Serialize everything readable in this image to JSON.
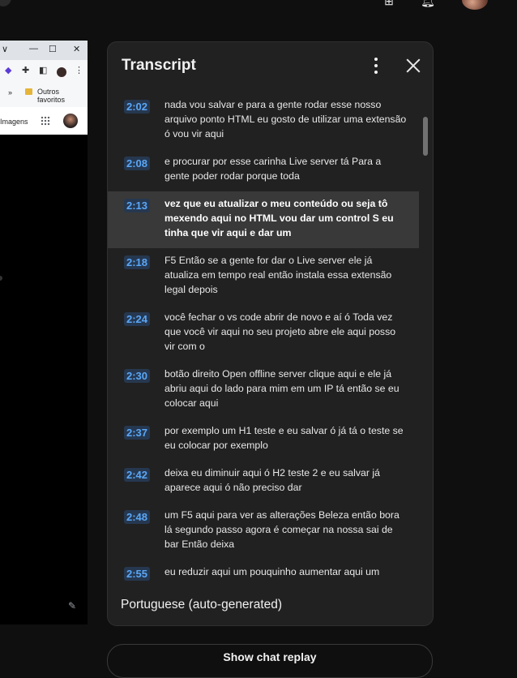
{
  "browser_preview": {
    "window_controls": [
      "∨",
      "—",
      "☐",
      "✕"
    ],
    "bookmarks_chevron": "»",
    "bookmark_folder_label": "Outros favoritos",
    "google_imagens_label": "Imagens"
  },
  "transcript": {
    "title": "Transcript",
    "language": "Portuguese (auto-generated)",
    "segments": [
      {
        "time": "2:02",
        "text": "nada vou salvar e para a gente rodar esse nosso arquivo ponto HTML eu gosto de utilizar uma extensão ó vou vir aqui"
      },
      {
        "time": "2:08",
        "text": "e procurar por esse carinha Live server tá Para a gente poder rodar porque toda"
      },
      {
        "time": "2:13",
        "text": "vez que eu atualizar o meu conteúdo ou seja tô mexendo aqui no HTML vou dar um control S eu tinha que vir aqui e dar um",
        "active": true
      },
      {
        "time": "2:18",
        "text": "F5 Então se a gente for dar o Live server ele já atualiza em tempo real então instala essa extensão legal depois"
      },
      {
        "time": "2:24",
        "text": "você fechar o vs code abrir de novo e aí ó Toda vez que você vir aqui no seu projeto abre ele aqui posso vir com o"
      },
      {
        "time": "2:30",
        "text": "botão direito Open offline server clique aqui e ele já abriu aqui do lado para mim em um IP tá então se eu colocar aqui"
      },
      {
        "time": "2:37",
        "text": "por exemplo um H1 teste e eu salvar ó já tá o teste se eu colocar por exemplo"
      },
      {
        "time": "2:42",
        "text": "deixa eu diminuir aqui ó H2 teste 2 e eu salvar já aparece aqui ó não preciso dar"
      },
      {
        "time": "2:48",
        "text": "um F5 aqui para ver as alterações Beleza então bora lá segundo passo agora é começar na nossa sai de bar Então deixa"
      },
      {
        "time": "2:55",
        "text": "eu reduzir aqui um pouquinho aumentar aqui um pouco"
      }
    ]
  },
  "below_panel": {
    "button_label": "Show chat replay"
  },
  "colors": {
    "timestamp_text": "#5aa7f7",
    "timestamp_bg": "#263850",
    "active_row": "#393939",
    "panel_bg": "#212121"
  }
}
